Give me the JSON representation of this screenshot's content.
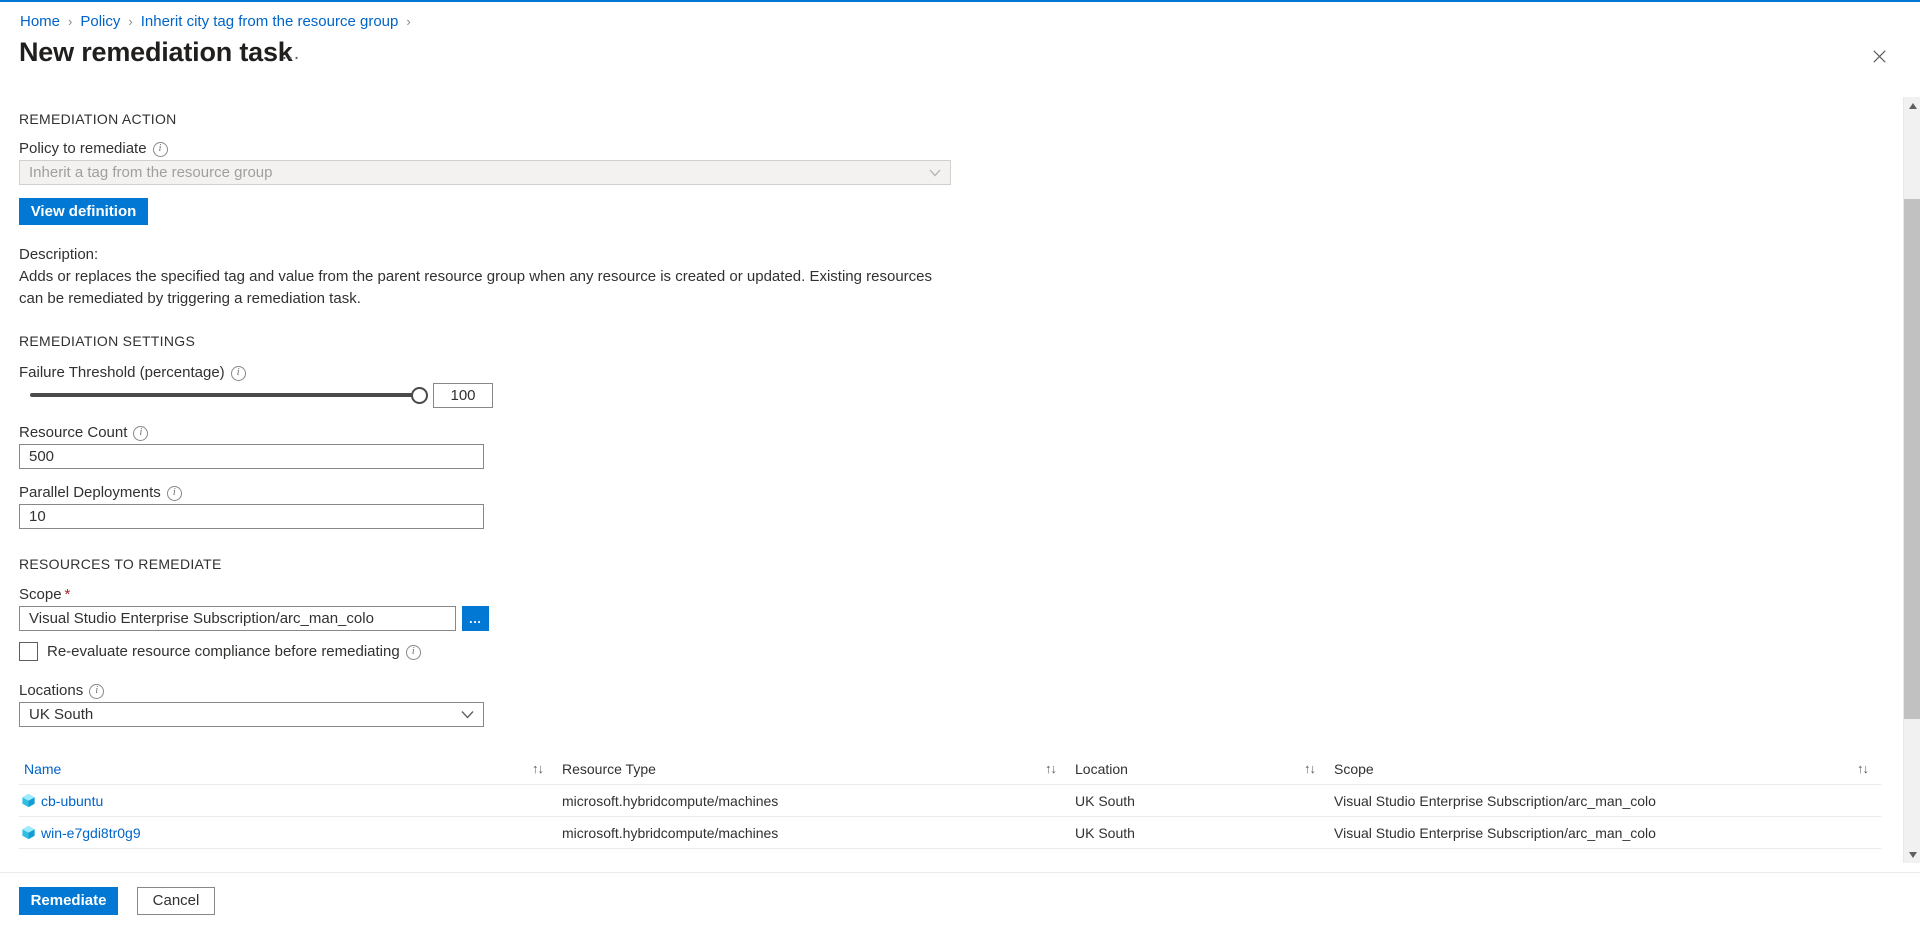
{
  "breadcrumb": {
    "items": [
      {
        "label": "Home"
      },
      {
        "label": "Policy"
      },
      {
        "label": "Inherit city tag from the resource group"
      }
    ],
    "separator": "›"
  },
  "header": {
    "title": "New remediation task",
    "more_menu": "…",
    "close_icon": "close-icon"
  },
  "sections": {
    "remediation_action": {
      "heading": "REMEDIATION ACTION",
      "policy_label": "Policy to remediate",
      "policy_value": "Inherit a tag from the resource group",
      "view_definition_label": "View definition",
      "description_heading": "Description:",
      "description_text": "Adds or replaces the specified tag and value from the parent resource group when any resource is created or updated. Existing resources can be remediated by triggering a remediation task."
    },
    "remediation_settings": {
      "heading": "REMEDIATION SETTINGS",
      "failure_threshold_label": "Failure Threshold (percentage)",
      "failure_threshold_value": "100",
      "failure_threshold_min": 0,
      "failure_threshold_max": 100,
      "resource_count_label": "Resource Count",
      "resource_count_value": "500",
      "parallel_deployments_label": "Parallel Deployments",
      "parallel_deployments_value": "10"
    },
    "resources_to_remediate": {
      "heading": "RESOURCES TO REMEDIATE",
      "scope_label": "Scope",
      "scope_required": "*",
      "scope_value": "Visual Studio Enterprise Subscription/arc_man_colo",
      "scope_browse_label": "…",
      "reevaluate_label": "Re-evaluate resource compliance before remediating",
      "reevaluate_checked": false,
      "locations_label": "Locations",
      "locations_value": "UK South"
    }
  },
  "table": {
    "columns": [
      {
        "label": "Name",
        "sort": "↑↓"
      },
      {
        "label": "Resource Type",
        "sort": "↑↓"
      },
      {
        "label": "Location",
        "sort": "↑↓"
      },
      {
        "label": "Scope",
        "sort": "↑↓"
      }
    ],
    "rows": [
      {
        "icon": "azure-arc-machine-icon",
        "name": "cb-ubuntu",
        "resource_type": "microsoft.hybridcompute/machines",
        "location": "UK South",
        "scope": "Visual Studio Enterprise Subscription/arc_man_colo"
      },
      {
        "icon": "azure-arc-machine-icon",
        "name": "win-e7gdi8tr0g9",
        "resource_type": "microsoft.hybridcompute/machines",
        "location": "UK South",
        "scope": "Visual Studio Enterprise Subscription/arc_man_colo"
      }
    ]
  },
  "footer": {
    "primary_label": "Remediate",
    "secondary_label": "Cancel"
  },
  "colors": {
    "accent": "#0078d4",
    "link": "#0064c8",
    "required": "#a4262c",
    "resource_icon": "#32bedd",
    "slider": "#4a4a4a"
  },
  "info_glyph": "i"
}
